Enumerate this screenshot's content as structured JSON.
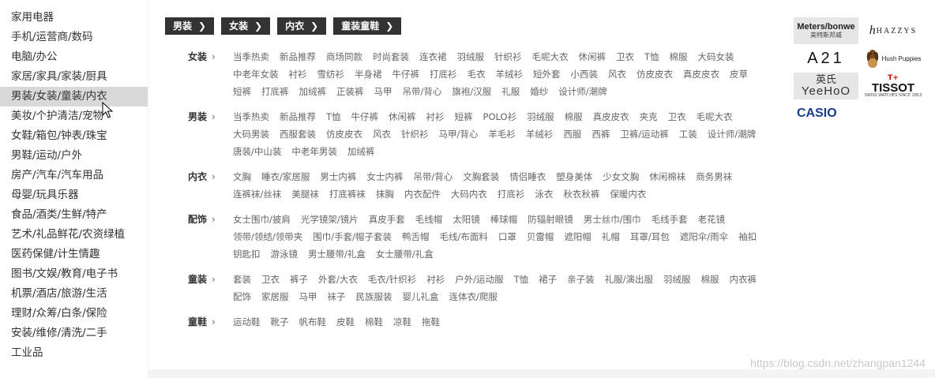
{
  "left_nav": {
    "items": [
      "家用电器",
      "手机/运营商/数码",
      "电脑/办公",
      "家居/家具/家装/厨具",
      "男装/女装/童装/内衣",
      "美妆/个护清洁/宠物",
      "女鞋/箱包/钟表/珠宝",
      "男鞋/运动/户外",
      "房产/汽车/汽车用品",
      "母婴/玩具乐器",
      "食品/酒类/生鲜/特产",
      "艺术/礼品鲜花/农资绿植",
      "医药保健/计生情趣",
      "图书/文娱/教育/电子书",
      "机票/酒店/旅游/生活",
      "理财/众筹/白条/保险",
      "安装/维修/清洗/二手",
      "工业品"
    ],
    "active_index": 4
  },
  "top_tabs": [
    "男装",
    "女装",
    "内衣",
    "童装童鞋"
  ],
  "categories": [
    {
      "title": "女装",
      "links": [
        "当季热卖",
        "新品推荐",
        "商场同款",
        "时尚套装",
        "连衣裙",
        "羽绒服",
        "针织衫",
        "毛呢大衣",
        "休闲裤",
        "卫衣",
        "T恤",
        "棉服",
        "大码女装",
        "中老年女装",
        "衬衫",
        "雪纺衫",
        "半身裙",
        "牛仔裤",
        "打底衫",
        "毛衣",
        "羊绒衫",
        "短外套",
        "小西装",
        "风衣",
        "仿皮皮衣",
        "真皮皮衣",
        "皮草",
        "短裤",
        "打底裤",
        "加绒裤",
        "正装裤",
        "马甲",
        "吊带/背心",
        "旗袍/汉服",
        "礼服",
        "婚纱",
        "设计师/潮牌"
      ]
    },
    {
      "title": "男装",
      "links": [
        "当季热卖",
        "新品推荐",
        "T恤",
        "牛仔裤",
        "休闲裤",
        "衬衫",
        "短裤",
        "POLO衫",
        "羽绒服",
        "棉服",
        "真皮皮衣",
        "夹克",
        "卫衣",
        "毛呢大衣",
        "大码男装",
        "西服套装",
        "仿皮皮衣",
        "风衣",
        "针织衫",
        "马甲/背心",
        "羊毛衫",
        "羊绒衫",
        "西服",
        "西裤",
        "卫裤/运动裤",
        "工装",
        "设计师/潮牌",
        "唐装/中山装",
        "中老年男装",
        "加绒裤"
      ]
    },
    {
      "title": "内衣",
      "links": [
        "文胸",
        "睡衣/家居服",
        "男士内裤",
        "女士内裤",
        "吊带/背心",
        "文胸套装",
        "情侣睡衣",
        "塑身美体",
        "少女文胸",
        "休闲棉袜",
        "商务男袜",
        "连裤袜/丝袜",
        "美腿袜",
        "打底裤袜",
        "抹胸",
        "内衣配件",
        "大码内衣",
        "打底衫",
        "泳衣",
        "秋衣秋裤",
        "保暖内衣"
      ]
    },
    {
      "title": "配饰",
      "links": [
        "女士围巾/披肩",
        "光学镜架/镜片",
        "真皮手套",
        "毛线帽",
        "太阳镜",
        "棒球帽",
        "防辐射眼镜",
        "男士丝巾/围巾",
        "毛线手套",
        "老花镜",
        "领带/领结/领带夹",
        "围巾/手套/帽子套装",
        "鸭舌帽",
        "毛线/布面料",
        "口罩",
        "贝雷帽",
        "遮阳帽",
        "礼帽",
        "耳罩/耳包",
        "遮阳伞/雨伞",
        "袖扣",
        "钥匙扣",
        "游泳镜",
        "男士腰带/礼盒",
        "女士腰带/礼盒"
      ]
    },
    {
      "title": "童装",
      "links": [
        "套装",
        "卫衣",
        "裤子",
        "外套/大衣",
        "毛衣/针织衫",
        "衬衫",
        "户外/运动服",
        "T恤",
        "裙子",
        "亲子装",
        "礼服/演出服",
        "羽绒服",
        "棉服",
        "内衣裤",
        "配饰",
        "家居服",
        "马甲",
        "袜子",
        "民族服装",
        "婴儿礼盒",
        "连体衣/爬服"
      ]
    },
    {
      "title": "童鞋",
      "links": [
        "运动鞋",
        "靴子",
        "帆布鞋",
        "皮鞋",
        "棉鞋",
        "凉鞋",
        "拖鞋"
      ]
    }
  ],
  "brands": {
    "meters": {
      "name": "Meters/bonwe",
      "cn": "美特斯邦威"
    },
    "hazzys": {
      "h": "h",
      "name": "HAZZYS"
    },
    "a21": {
      "name": "A21"
    },
    "hush": {
      "name": "Hush Puppies"
    },
    "yeehoo": {
      "cn": "英氏",
      "name": "YeeHoO"
    },
    "tissot": {
      "cross": "T+",
      "name": "TISSOT",
      "sub": "SWISS WATCHES SINCE 1853"
    },
    "casio": {
      "name": "CASIO"
    }
  },
  "watermark": "https://blog.csdn.net/zhangpan1244",
  "colors": {
    "tab_bg": "#333333",
    "active_nav_bg": "#d9d9d9",
    "link_text": "#666666"
  }
}
